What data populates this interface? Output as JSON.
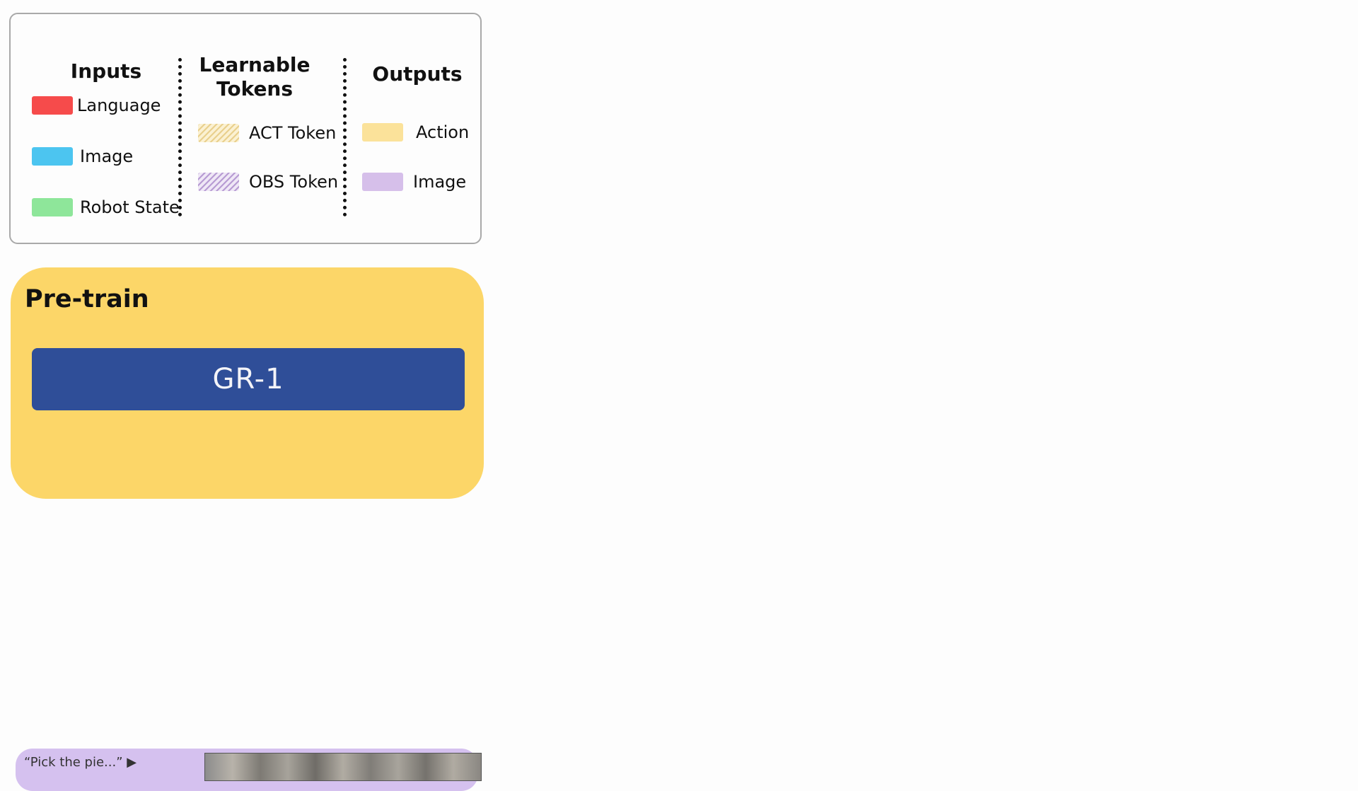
{
  "legend": {
    "inputs": {
      "heading": "Inputs",
      "items": [
        {
          "label": "Language",
          "color": "#f64b4b"
        },
        {
          "label": "Image",
          "color": "#4cc5f0"
        },
        {
          "label": "Robot State",
          "color": "#8ee69a"
        }
      ]
    },
    "tokens": {
      "heading_line1": "Learnable",
      "heading_line2": "Tokens",
      "items": [
        {
          "label": "ACT Token",
          "color": "#e9d08d",
          "pattern": "hatched"
        },
        {
          "label": "OBS Token",
          "color": "#b79bd3",
          "pattern": "hatched"
        }
      ]
    },
    "outputs": {
      "heading": "Outputs",
      "items": [
        {
          "label": "Action",
          "color": "#fbe29a"
        },
        {
          "label": "Image",
          "color": "#d6bfea"
        }
      ]
    }
  },
  "pretrain": {
    "title": "Pre-train",
    "model_label": "GR-1",
    "background_color": "#fcd668",
    "model_color": "#2f4e98"
  },
  "bottom_panel": {
    "text": "“Pick the pie...” ▶",
    "background_color": "#d5c1ef"
  }
}
